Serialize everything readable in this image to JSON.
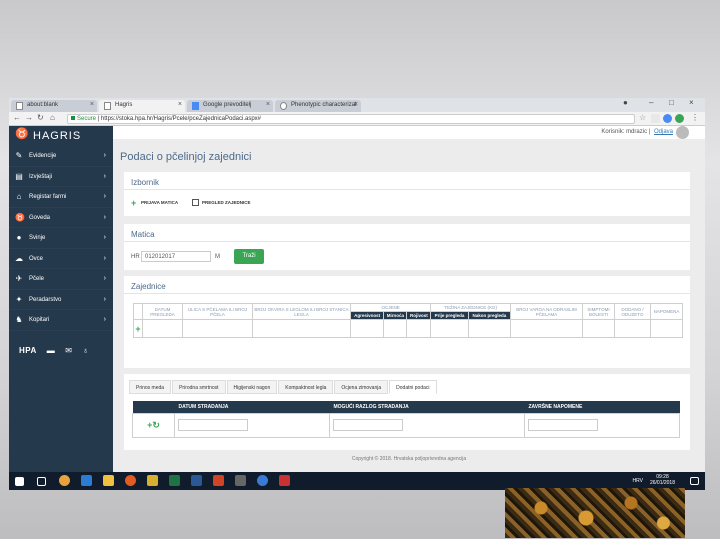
{
  "browser": {
    "tabs": [
      "about:blank",
      "Hagris",
      "Google prevoditelj",
      "Phenotypic characterizat"
    ],
    "secure_label": "Secure",
    "url": "https://stoka.hpa.hr/Hagris/Pcele/pceZajednicaPodaci.aspx#"
  },
  "app": {
    "logo": "HAGRIS",
    "sidebar": [
      {
        "label": "Evidencije",
        "icon": "edit-icon"
      },
      {
        "label": "Izvještaji",
        "icon": "report-icon"
      },
      {
        "label": "Registar farmi",
        "icon": "farm-icon"
      },
      {
        "label": "Goveda",
        "icon": "cattle-icon"
      },
      {
        "label": "Svinje",
        "icon": "pig-icon"
      },
      {
        "label": "Ovce",
        "icon": "sheep-icon"
      },
      {
        "label": "Pčele",
        "icon": "bee-icon"
      },
      {
        "label": "Peradarstvo",
        "icon": "poultry-icon"
      },
      {
        "label": "Kopitari",
        "icon": "horse-icon"
      }
    ],
    "hpa_logo": "HPA"
  },
  "userbar": {
    "prefix": "Korisnik:",
    "user": "mdrazic",
    "separator": "|",
    "logout": "Odjava"
  },
  "page": {
    "title": "Podaci o pčelinjoj zajednici",
    "izbornik": {
      "title": "Izbornik",
      "prijava": "PRIJAVA MATICA",
      "pregled": "PREGLED ZAJEDNICE"
    },
    "matica": {
      "title": "Matica",
      "hr": "HR",
      "value": "012012017",
      "m": "M",
      "button": "Traži"
    },
    "zajednice": {
      "title": "Zajednice",
      "headers": {
        "datum": "DATUM PREGLEDA",
        "ulica": "ULICA S PČELAMA ILI BROJ PČELA",
        "okvir": "BROJ OKVIRA S LEGLOM ILI BROJ STANICA LEGLA",
        "ocjene": "OCJENE",
        "agresivnost": "Agresivnost",
        "mirnoca": "Mirnoća",
        "rojivost": "Rojivost",
        "tezina": "TEŽINA ZAJEDNICE (KG)",
        "prije": "Prije pregleda",
        "nakon": "Nakon pregleda",
        "varoa": "BROJ VAROA NA ODRASLIM PČELAMA",
        "simptomi": "SIMPTOMI BOLESTI",
        "dodano": "DODANO / ODUZETO",
        "napomena": "NAPOMENA"
      }
    },
    "tabs": [
      "Prinos meda",
      "Prirodna smrtnost",
      "Higijenski nagon",
      "Kompaktnost legla",
      "Ocjena zimovanja",
      "Dodatni podaci"
    ],
    "stradanja": {
      "datum": "DATUM STRADANJA",
      "razlog": "MOGUĆI RAZLOG STRADANJA",
      "napomene": "ZAVRŠNE NAPOMENE"
    },
    "footer": "Copyright © 2018. Hrvatska poljoprivredna agencija"
  },
  "taskbar": {
    "lang": "HRV",
    "time": "09:28",
    "date": "26/01/2018"
  }
}
